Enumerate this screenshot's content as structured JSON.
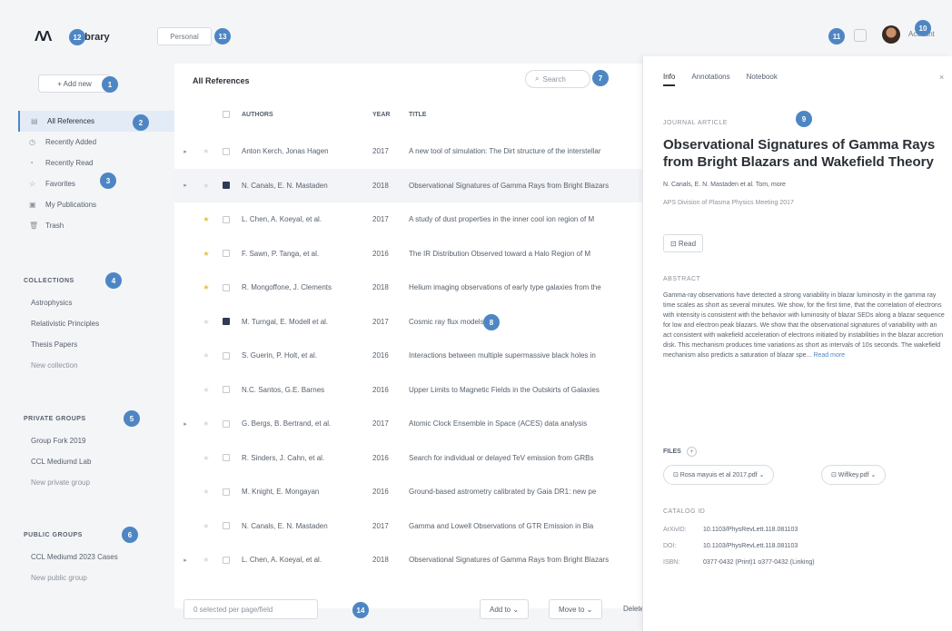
{
  "badges": [
    "12",
    "13",
    "11",
    "10",
    "1",
    "2",
    "3",
    "4",
    "5",
    "6",
    "7",
    "8",
    "9"
  ],
  "topbar": {
    "logo_text": "Library",
    "library_tab": "Personal",
    "user_menu": "Account"
  },
  "sidebar": {
    "add_new": "+ Add new",
    "nav": [
      {
        "icon": "▤",
        "label": "All References",
        "active": true
      },
      {
        "icon": "◷",
        "label": "Recently Added",
        "active": false
      },
      {
        "icon": "◔",
        "label": "Recently Read",
        "active": false
      },
      {
        "icon": "☆",
        "label": "Favorites",
        "active": false
      },
      {
        "icon": "▣",
        "label": "My Publications",
        "active": false
      },
      {
        "icon": "🗑",
        "label": "Trash",
        "active": false
      }
    ],
    "collections": {
      "title": "COLLECTIONS",
      "items": [
        "Astrophysics",
        "Relativistic Principles",
        "Thesis Papers"
      ],
      "new_link": "New collection"
    },
    "private_groups": {
      "title": "PRIVATE GROUPS",
      "items": [
        "Group Fork 2019",
        "CCL Mediumd Lab"
      ],
      "new_link": "New private group"
    },
    "public_groups": {
      "title": "PUBLIC GROUPS",
      "items": [
        "CCL Mediumd 2023 Cases"
      ],
      "new_link": "New public group"
    }
  },
  "main": {
    "header": "All References",
    "search_placeholder": "Search",
    "columns": {
      "authors": "AUTHORS",
      "year": "YEAR",
      "title": "TITLE"
    },
    "rows": [
      {
        "exp": "▸",
        "star": false,
        "checked": false,
        "selected": false,
        "authors": "Anton Kerch, Jonas Hagen",
        "year": "2017",
        "title": "A new tool of simulation: The Dirt structure of the interstellar"
      },
      {
        "exp": "▸",
        "star": false,
        "checked": true,
        "selected": true,
        "authors": "N. Canals, E. N. Mastaden",
        "year": "2018",
        "title": "Observational Signatures of Gamma Rays from Bright Blazars"
      },
      {
        "exp": "",
        "star": true,
        "checked": false,
        "selected": false,
        "authors": "L. Chen, A. Koeyal, et al.",
        "year": "2017",
        "title": "A study of dust properties in the inner cool ion region of M"
      },
      {
        "exp": "",
        "star": true,
        "checked": false,
        "selected": false,
        "authors": "F. Sawn, P. Tanga, et al.",
        "year": "2016",
        "title": "The IR Distribution Observed toward a Halo Region of M"
      },
      {
        "exp": "",
        "star": true,
        "checked": false,
        "selected": false,
        "authors": "R. Mongoffone, J. Clements",
        "year": "2018",
        "title": "Helium imaging observations of early type galaxies from the"
      },
      {
        "exp": "",
        "star": false,
        "checked": true,
        "selected": false,
        "authors": "M. Turngal, E. Modell et al.",
        "year": "2017",
        "title": "Cosmic ray flux models"
      },
      {
        "exp": "",
        "star": false,
        "checked": false,
        "selected": false,
        "authors": "S. Guerin, P. Holt, et al.",
        "year": "2016",
        "title": "Interactions between multiple supermassive black holes in"
      },
      {
        "exp": "",
        "star": false,
        "checked": false,
        "selected": false,
        "authors": "N.C. Santos, G.E. Barnes",
        "year": "2016",
        "title": "Upper Limits to Magnetic Fields in the Outskirts of Galaxies"
      },
      {
        "exp": "▸",
        "star": false,
        "checked": false,
        "selected": false,
        "authors": "G. Bergs, B. Bertrand, et al.",
        "year": "2017",
        "title": "Atomic Clock Ensemble in Space (ACES) data analysis"
      },
      {
        "exp": "",
        "star": false,
        "checked": false,
        "selected": false,
        "authors": "R. Sinders, J. Cahn, et al.",
        "year": "2016",
        "title": "Search for individual or delayed TeV emission from GRBs"
      },
      {
        "exp": "",
        "star": false,
        "checked": false,
        "selected": false,
        "authors": "M. Knight, E. Mongayan",
        "year": "2016",
        "title": "Ground-based astrometry calibrated by Gaia DR1: new pe"
      },
      {
        "exp": "",
        "star": false,
        "checked": false,
        "selected": false,
        "authors": "N. Canals, E. N. Mastaden",
        "year": "2017",
        "title": "Gamma and Lowell Observations of GTR Emission in Bla"
      },
      {
        "exp": "▸",
        "star": false,
        "checked": false,
        "selected": false,
        "authors": "L. Chen, A. Koeyal, et al.",
        "year": "2018",
        "title": "Observational Signatures of Gamma Rays from Bright Blazars"
      }
    ]
  },
  "bottombar": {
    "input_placeholder": "0 selected per page/field",
    "add_to": "Add to ⌄",
    "move_to": "Move to ⌄",
    "delete": "Delete"
  },
  "detail": {
    "tabs": [
      "Info",
      "Annotations",
      "Notebook"
    ],
    "close": "×",
    "type": "JOURNAL ARTICLE",
    "title": "Observational Signatures of Gamma Rays from Bright Blazars and Wakefield Theory",
    "authors": "N. Canals, E. N. Mastaden et al. Tom, more",
    "venue": "APS Division of Plasma Physics Meeting 2017",
    "read_button": "⊡ Read",
    "abstract_label": "ABSTRACT",
    "abstract": "Gamma-ray observations have detected a strong variability in blazar luminosity in the gamma ray time scales as short as several minutes. We show, for the first time, that the correlation of electrons with intensity is consistent with the behavior with luminosity of blazar SEDs along a blazar sequence for low and electron peak blazars. We show that the observational signatures of variability with an act consistent with wakefield acceleration of electrons initiated by instabilities in the blazar accretion disk. This mechanism produces time variations as short as intervals of 10s seconds. The wakefield mechanism also predicts a saturation of blazar spe...",
    "read_more": "Read more",
    "files_label": "FILES",
    "files": [
      "⊡ Rosa mayuis et al 2017.pdf ⌄",
      "⊡ Wiflkey.pdf ⌄"
    ],
    "catalog_label": "CATALOG ID",
    "catalog": [
      {
        "key": "ArXivID:",
        "value": "10.1103/PhysRevLett.118.081103"
      },
      {
        "key": "DOI:",
        "value": "10.1103/PhysRevLett.118.081103"
      },
      {
        "key": "ISBN:",
        "value": "0377-0432 (Print)1 o377-0432 (Linking)"
      }
    ]
  }
}
